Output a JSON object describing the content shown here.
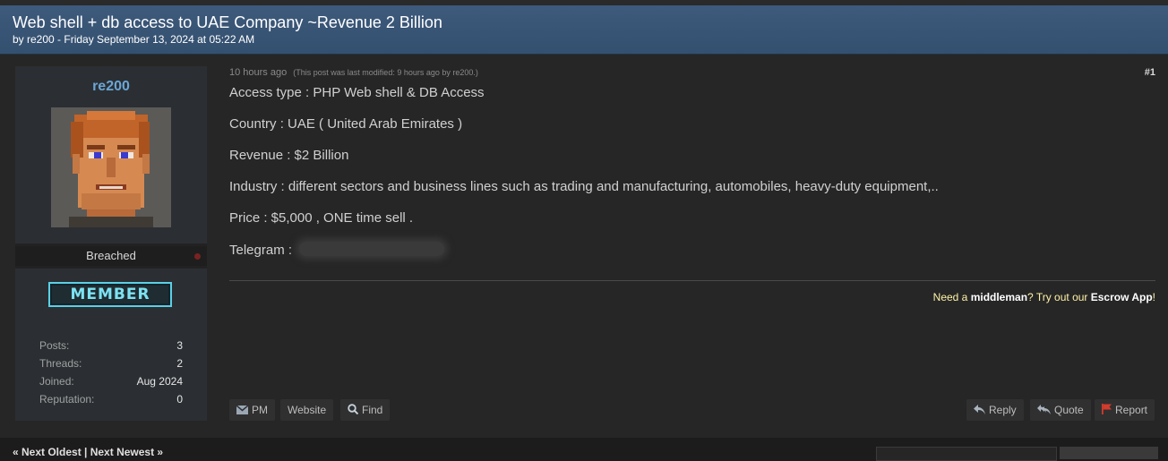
{
  "thread": {
    "title": "Web shell + db access to UAE Company ~Revenue 2 Billion",
    "meta": "by re200 - Friday September 13, 2024 at 05:22 AM"
  },
  "author": {
    "username": "re200",
    "usergroup": "Breached",
    "badge": "MEMBER",
    "stats": [
      {
        "label": "Posts:",
        "value": "3"
      },
      {
        "label": "Threads:",
        "value": "2"
      },
      {
        "label": "Joined:",
        "value": "Aug 2024"
      },
      {
        "label": "Reputation:",
        "value": "0"
      }
    ]
  },
  "post": {
    "time": "10 hours ago",
    "modified": "(This post was last modified: 9 hours ago by re200.)",
    "number": "#1",
    "lines": [
      "Access type : PHP Web shell & DB Access",
      "Country : UAE ( United Arab Emirates )",
      "Revenue : $2 Billion",
      "Industry : different sectors and business lines such as trading and manufacturing, automobiles, heavy-duty equipment,..",
      "Price : $5,000 , ONE time sell ."
    ],
    "telegram_label": "Telegram :",
    "signature": {
      "pre": "Need a ",
      "middleman": "middleman",
      "mid": "? Try out our ",
      "escrow": "Escrow App",
      "end": "!"
    }
  },
  "buttons": {
    "pm": "PM",
    "website": "Website",
    "find": "Find",
    "reply": "Reply",
    "quote": "Quote",
    "report": "Report"
  },
  "footer": {
    "pager": "« Next Oldest | Next Newest »"
  },
  "colors": {
    "header": "#3e5a7c",
    "username": "#6aa6d6",
    "badge": "#5ad0e6",
    "report_flag": "#d33b2c"
  }
}
